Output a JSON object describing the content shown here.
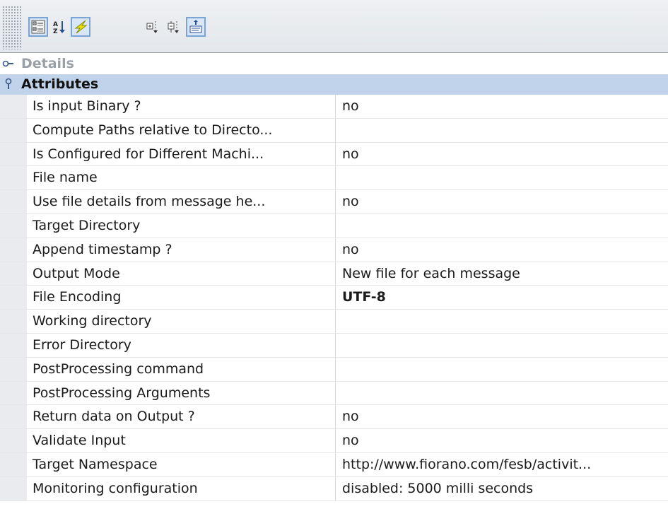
{
  "toolbar": {
    "buttons": [
      {
        "icon": "categorized-view-icon",
        "active": true
      },
      {
        "icon": "sort-alphabetical-icon",
        "active": false
      },
      {
        "icon": "lightning-icon",
        "active": true
      },
      {
        "icon": "expand-all-icon",
        "active": false
      },
      {
        "icon": "collapse-all-icon",
        "active": false
      },
      {
        "icon": "show-description-icon",
        "active": true
      }
    ]
  },
  "categories": {
    "details": {
      "label": "Details",
      "expanded": false
    },
    "attributes": {
      "label": "Attributes",
      "expanded": true
    }
  },
  "properties": [
    {
      "name": "Is input Binary ?",
      "value": "no"
    },
    {
      "name": "Compute Paths relative to Directo...",
      "value": ""
    },
    {
      "name": "Is Configured for Different Machi...",
      "value": "no"
    },
    {
      "name": "File name",
      "value": ""
    },
    {
      "name": "Use file details from message he...",
      "value": "no"
    },
    {
      "name": "Target Directory",
      "value": ""
    },
    {
      "name": "Append timestamp ?",
      "value": "no"
    },
    {
      "name": "Output Mode",
      "value": "New file for each message"
    },
    {
      "name": "File Encoding",
      "value": "UTF-8",
      "bold": true
    },
    {
      "name": "Working directory",
      "value": ""
    },
    {
      "name": "Error Directory",
      "value": ""
    },
    {
      "name": "PostProcessing command",
      "value": ""
    },
    {
      "name": "PostProcessing Arguments",
      "value": ""
    },
    {
      "name": "Return data on Output ?",
      "value": "no"
    },
    {
      "name": "Validate Input",
      "value": "no"
    },
    {
      "name": "Target Namespace",
      "value": "http://www.fiorano.com/fesb/activit..."
    },
    {
      "name": "Monitoring configuration",
      "value": "disabled: 5000 milli seconds"
    }
  ],
  "colors": {
    "category_selected_bg": "#c0d3ea",
    "gutter_bg": "#e9ebee",
    "active_button_border": "#7aa3d6"
  }
}
